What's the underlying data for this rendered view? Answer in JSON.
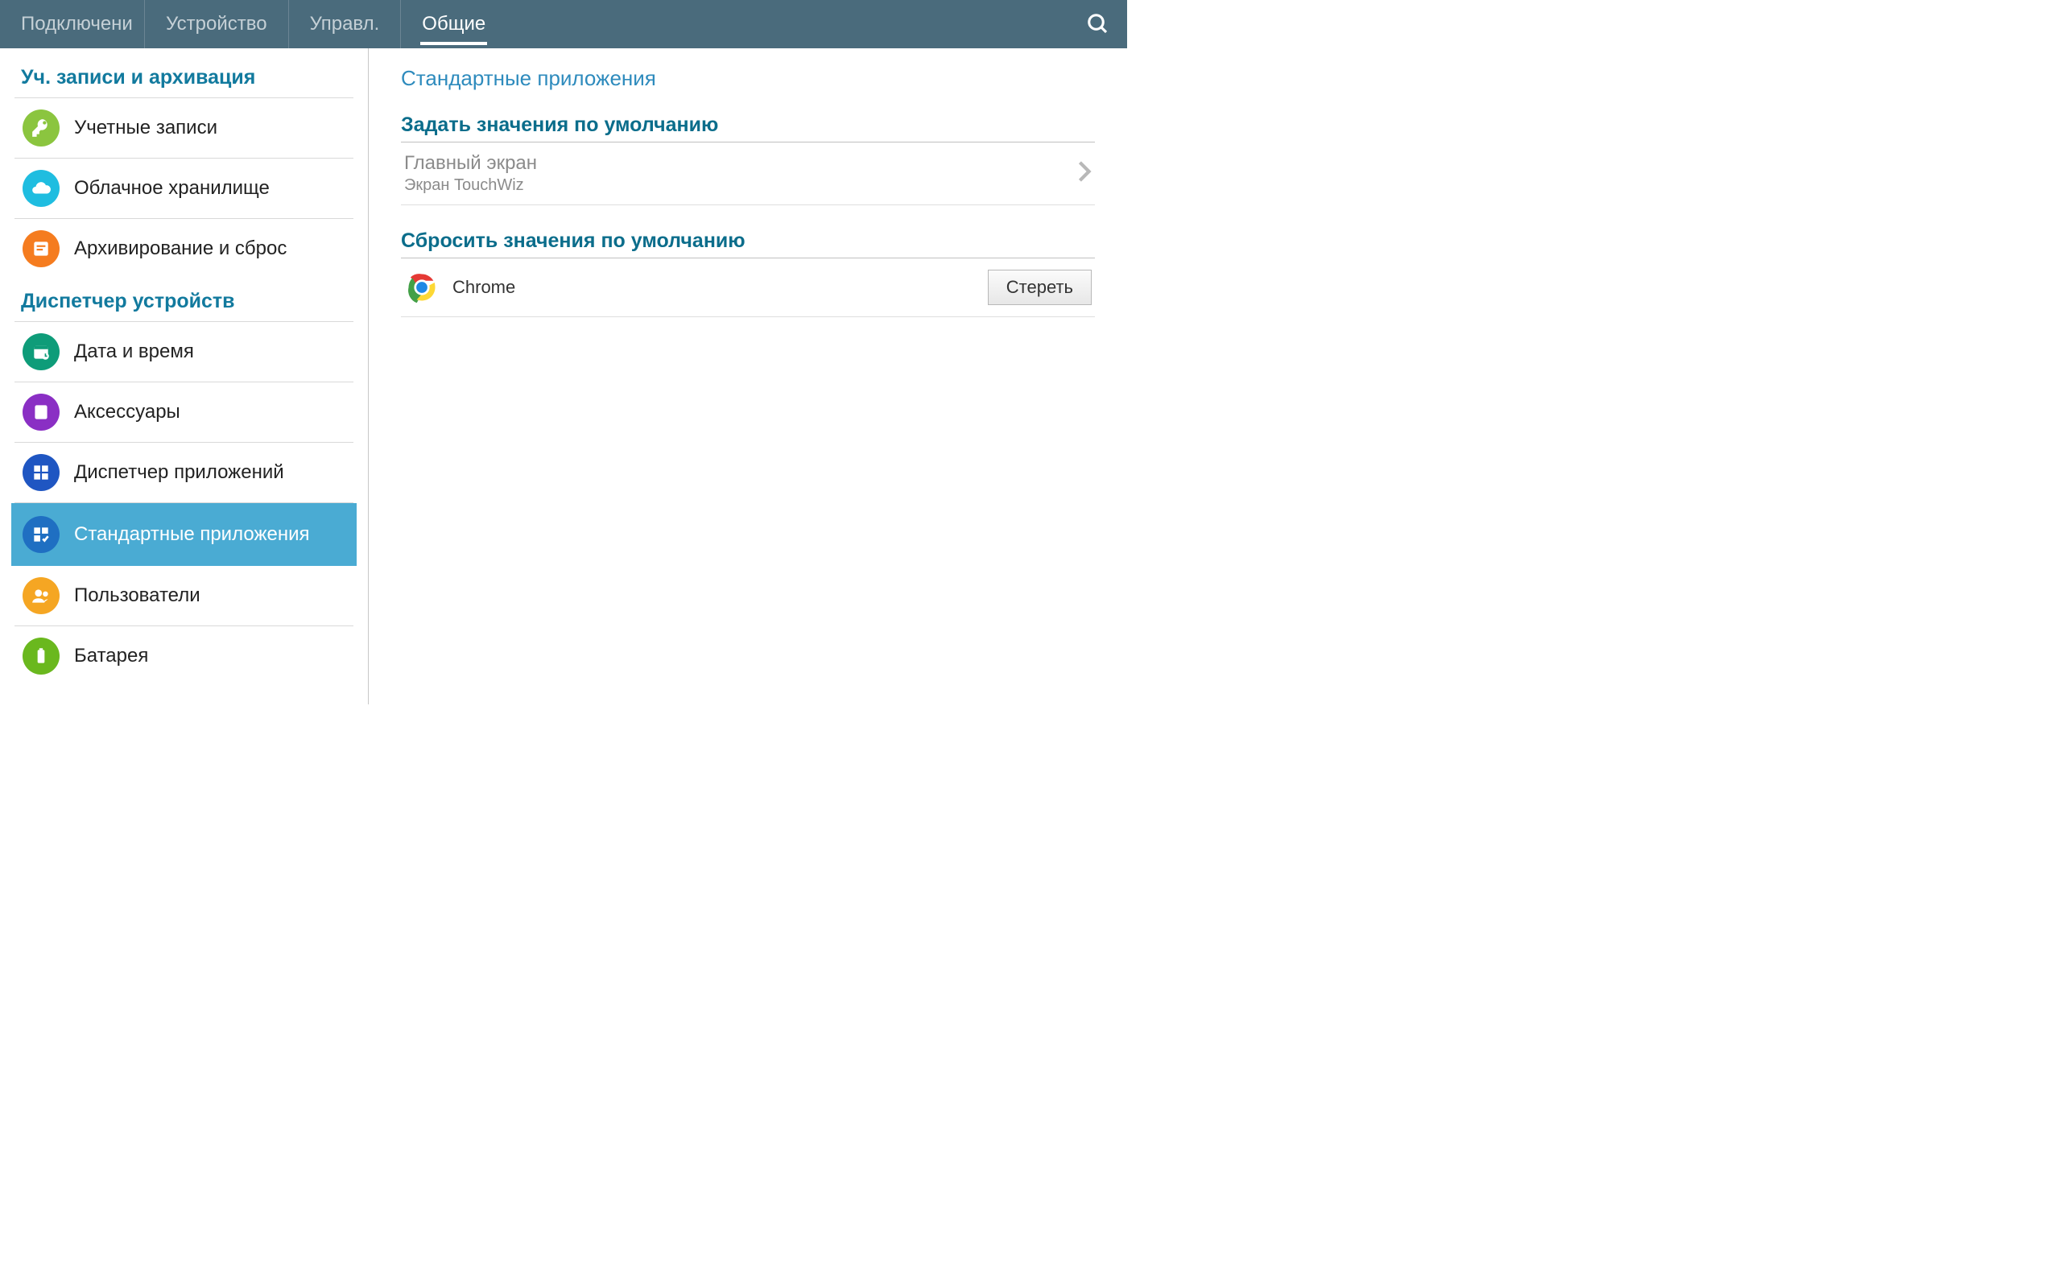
{
  "tabs": {
    "connections": "Подключени",
    "device": "Устройство",
    "controls": "Управл.",
    "general": "Общие"
  },
  "sidebar": {
    "section_accounts": "Уч. записи и архивация",
    "items_accounts": {
      "accounts": "Учетные записи",
      "cloud": "Облачное хранилище",
      "backup": "Архивирование и сброс"
    },
    "section_device_mgr": "Диспетчер устройств",
    "items_device": {
      "datetime": "Дата и время",
      "accessories": "Аксессуары",
      "appmgr": "Диспетчер приложений",
      "default_apps": "Стандартные приложения",
      "users": "Пользователи",
      "battery": "Батарея"
    }
  },
  "content": {
    "title": "Стандартные приложения",
    "set_defaults_hdr": "Задать значения по умолчанию",
    "home_primary": "Главный экран",
    "home_secondary": "Экран TouchWiz",
    "reset_defaults_hdr": "Сбросить значения по умолчанию",
    "app1_name": "Chrome",
    "clear_btn": "Стереть"
  }
}
